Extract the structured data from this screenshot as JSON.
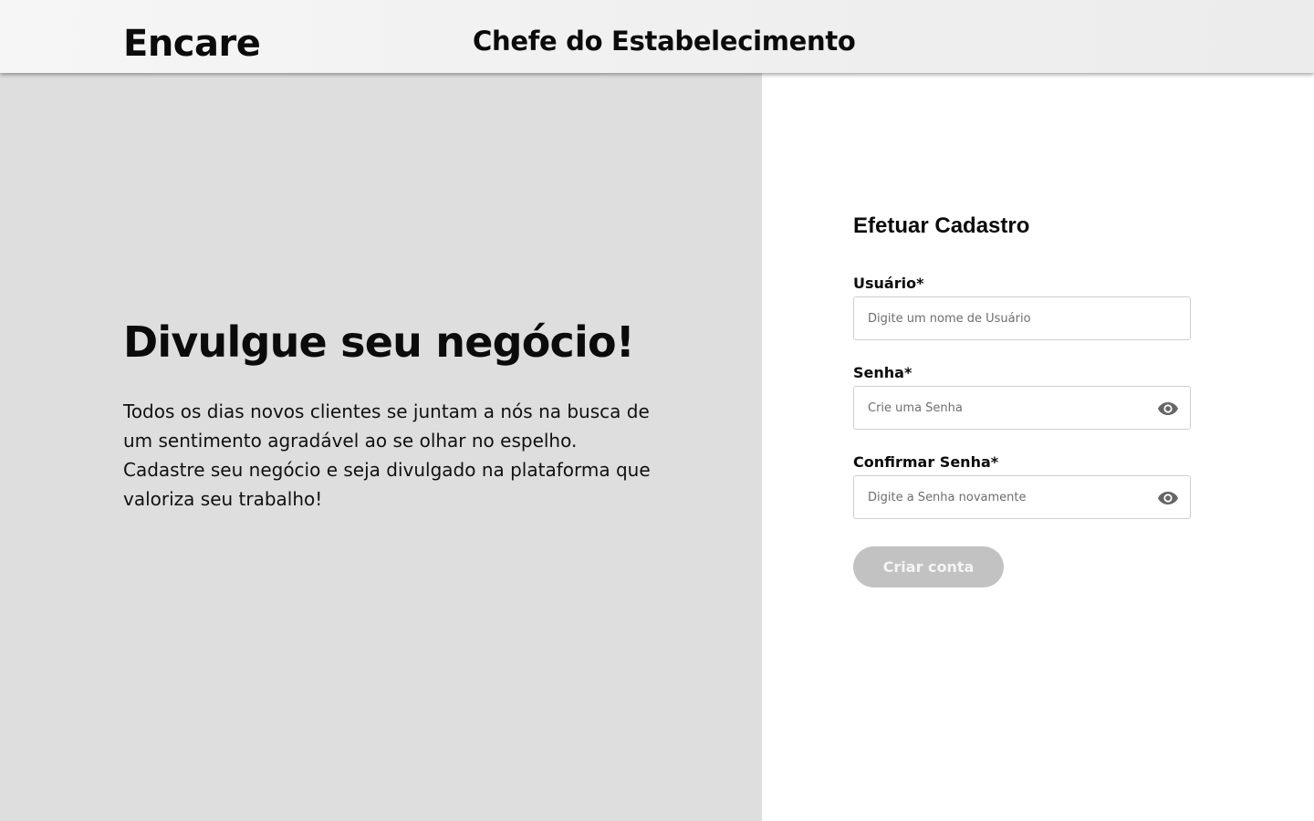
{
  "header": {
    "logo": "Encare",
    "title": "Chefe do Estabelecimento"
  },
  "hero": {
    "title": "Divulgue seu negócio!",
    "text": "Todos os dias novos clientes se juntam a nós na busca de um sentimento agradável ao se olhar no espelho. Cadastre seu negócio e seja divulgado na plataforma que valoriza seu trabalho!"
  },
  "form": {
    "title": "Efetuar Cadastro",
    "username": {
      "label": "Usuário*",
      "placeholder": "Digite um nome de Usuário",
      "value": ""
    },
    "password": {
      "label": "Senha*",
      "placeholder": "Crie uma Senha",
      "value": "",
      "icon": "eye-icon"
    },
    "confirm": {
      "label": "Confirmar Senha*",
      "placeholder": "Digite a Senha novamente",
      "value": "",
      "icon": "eye-icon"
    },
    "submit_label": "Criar conta"
  },
  "colors": {
    "header_bg": "#efefef",
    "left_panel_bg": "#dedede",
    "button_disabled_bg": "#c2c2c2",
    "button_text": "#f4f4f4",
    "icon": "#666666"
  }
}
